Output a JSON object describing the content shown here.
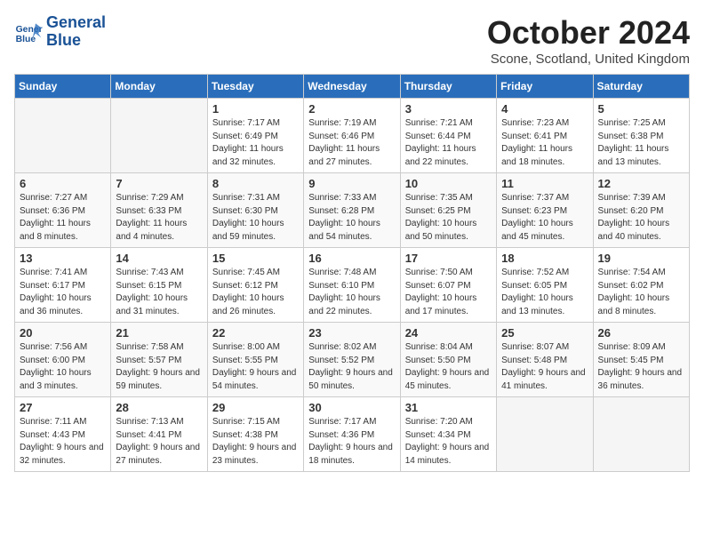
{
  "header": {
    "logo_line1": "General",
    "logo_line2": "Blue",
    "month_title": "October 2024",
    "location": "Scone, Scotland, United Kingdom"
  },
  "days_of_week": [
    "Sunday",
    "Monday",
    "Tuesday",
    "Wednesday",
    "Thursday",
    "Friday",
    "Saturday"
  ],
  "weeks": [
    [
      {
        "day": "",
        "detail": ""
      },
      {
        "day": "",
        "detail": ""
      },
      {
        "day": "1",
        "detail": "Sunrise: 7:17 AM\nSunset: 6:49 PM\nDaylight: 11 hours and 32 minutes."
      },
      {
        "day": "2",
        "detail": "Sunrise: 7:19 AM\nSunset: 6:46 PM\nDaylight: 11 hours and 27 minutes."
      },
      {
        "day": "3",
        "detail": "Sunrise: 7:21 AM\nSunset: 6:44 PM\nDaylight: 11 hours and 22 minutes."
      },
      {
        "day": "4",
        "detail": "Sunrise: 7:23 AM\nSunset: 6:41 PM\nDaylight: 11 hours and 18 minutes."
      },
      {
        "day": "5",
        "detail": "Sunrise: 7:25 AM\nSunset: 6:38 PM\nDaylight: 11 hours and 13 minutes."
      }
    ],
    [
      {
        "day": "6",
        "detail": "Sunrise: 7:27 AM\nSunset: 6:36 PM\nDaylight: 11 hours and 8 minutes."
      },
      {
        "day": "7",
        "detail": "Sunrise: 7:29 AM\nSunset: 6:33 PM\nDaylight: 11 hours and 4 minutes."
      },
      {
        "day": "8",
        "detail": "Sunrise: 7:31 AM\nSunset: 6:30 PM\nDaylight: 10 hours and 59 minutes."
      },
      {
        "day": "9",
        "detail": "Sunrise: 7:33 AM\nSunset: 6:28 PM\nDaylight: 10 hours and 54 minutes."
      },
      {
        "day": "10",
        "detail": "Sunrise: 7:35 AM\nSunset: 6:25 PM\nDaylight: 10 hours and 50 minutes."
      },
      {
        "day": "11",
        "detail": "Sunrise: 7:37 AM\nSunset: 6:23 PM\nDaylight: 10 hours and 45 minutes."
      },
      {
        "day": "12",
        "detail": "Sunrise: 7:39 AM\nSunset: 6:20 PM\nDaylight: 10 hours and 40 minutes."
      }
    ],
    [
      {
        "day": "13",
        "detail": "Sunrise: 7:41 AM\nSunset: 6:17 PM\nDaylight: 10 hours and 36 minutes."
      },
      {
        "day": "14",
        "detail": "Sunrise: 7:43 AM\nSunset: 6:15 PM\nDaylight: 10 hours and 31 minutes."
      },
      {
        "day": "15",
        "detail": "Sunrise: 7:45 AM\nSunset: 6:12 PM\nDaylight: 10 hours and 26 minutes."
      },
      {
        "day": "16",
        "detail": "Sunrise: 7:48 AM\nSunset: 6:10 PM\nDaylight: 10 hours and 22 minutes."
      },
      {
        "day": "17",
        "detail": "Sunrise: 7:50 AM\nSunset: 6:07 PM\nDaylight: 10 hours and 17 minutes."
      },
      {
        "day": "18",
        "detail": "Sunrise: 7:52 AM\nSunset: 6:05 PM\nDaylight: 10 hours and 13 minutes."
      },
      {
        "day": "19",
        "detail": "Sunrise: 7:54 AM\nSunset: 6:02 PM\nDaylight: 10 hours and 8 minutes."
      }
    ],
    [
      {
        "day": "20",
        "detail": "Sunrise: 7:56 AM\nSunset: 6:00 PM\nDaylight: 10 hours and 3 minutes."
      },
      {
        "day": "21",
        "detail": "Sunrise: 7:58 AM\nSunset: 5:57 PM\nDaylight: 9 hours and 59 minutes."
      },
      {
        "day": "22",
        "detail": "Sunrise: 8:00 AM\nSunset: 5:55 PM\nDaylight: 9 hours and 54 minutes."
      },
      {
        "day": "23",
        "detail": "Sunrise: 8:02 AM\nSunset: 5:52 PM\nDaylight: 9 hours and 50 minutes."
      },
      {
        "day": "24",
        "detail": "Sunrise: 8:04 AM\nSunset: 5:50 PM\nDaylight: 9 hours and 45 minutes."
      },
      {
        "day": "25",
        "detail": "Sunrise: 8:07 AM\nSunset: 5:48 PM\nDaylight: 9 hours and 41 minutes."
      },
      {
        "day": "26",
        "detail": "Sunrise: 8:09 AM\nSunset: 5:45 PM\nDaylight: 9 hours and 36 minutes."
      }
    ],
    [
      {
        "day": "27",
        "detail": "Sunrise: 7:11 AM\nSunset: 4:43 PM\nDaylight: 9 hours and 32 minutes."
      },
      {
        "day": "28",
        "detail": "Sunrise: 7:13 AM\nSunset: 4:41 PM\nDaylight: 9 hours and 27 minutes."
      },
      {
        "day": "29",
        "detail": "Sunrise: 7:15 AM\nSunset: 4:38 PM\nDaylight: 9 hours and 23 minutes."
      },
      {
        "day": "30",
        "detail": "Sunrise: 7:17 AM\nSunset: 4:36 PM\nDaylight: 9 hours and 18 minutes."
      },
      {
        "day": "31",
        "detail": "Sunrise: 7:20 AM\nSunset: 4:34 PM\nDaylight: 9 hours and 14 minutes."
      },
      {
        "day": "",
        "detail": ""
      },
      {
        "day": "",
        "detail": ""
      }
    ]
  ]
}
